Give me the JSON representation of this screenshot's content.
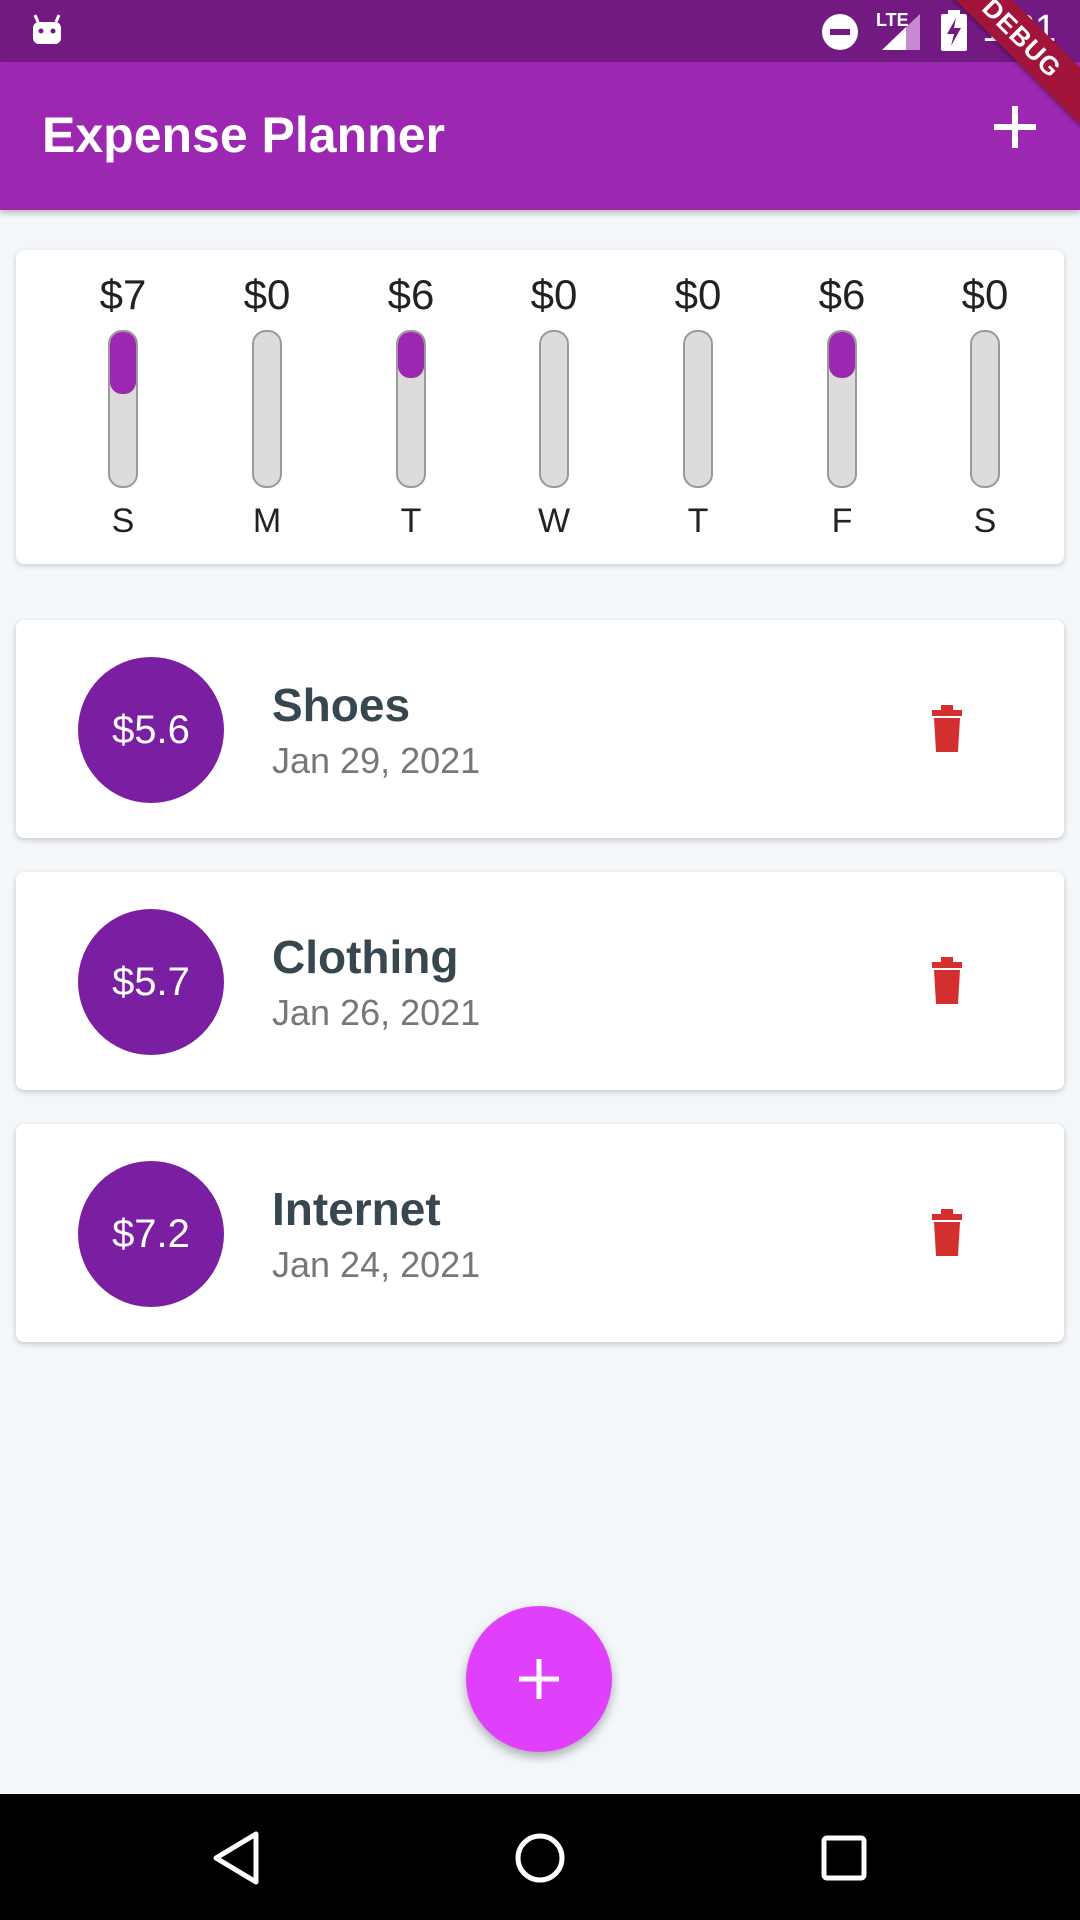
{
  "status_bar": {
    "time": "1:21",
    "network": "LTE"
  },
  "app_bar": {
    "title": "Expense Planner",
    "add_icon": "plus-icon",
    "debug_label": "DEBUG"
  },
  "chart": {
    "days": [
      {
        "amount": "$7",
        "day": "S",
        "fill": 0.4
      },
      {
        "amount": "$0",
        "day": "M",
        "fill": 0.0
      },
      {
        "amount": "$6",
        "day": "T",
        "fill": 0.3
      },
      {
        "amount": "$0",
        "day": "W",
        "fill": 0.0
      },
      {
        "amount": "$0",
        "day": "T",
        "fill": 0.0
      },
      {
        "amount": "$6",
        "day": "F",
        "fill": 0.3
      },
      {
        "amount": "$0",
        "day": "S",
        "fill": 0.0
      }
    ],
    "accent": "#9c27b0"
  },
  "transactions": [
    {
      "amount": "$5.6",
      "title": "Shoes",
      "date": "Jan 29, 2021"
    },
    {
      "amount": "$5.7",
      "title": "Clothing",
      "date": "Jan 26, 2021"
    },
    {
      "amount": "$7.2",
      "title": "Internet",
      "date": "Jan 24, 2021"
    }
  ],
  "colors": {
    "app_bar": "#9c27b0",
    "status_bar": "#731a82",
    "avatar": "#7b1fa2",
    "delete": "#d32f2f",
    "fab": "#e040fb"
  }
}
